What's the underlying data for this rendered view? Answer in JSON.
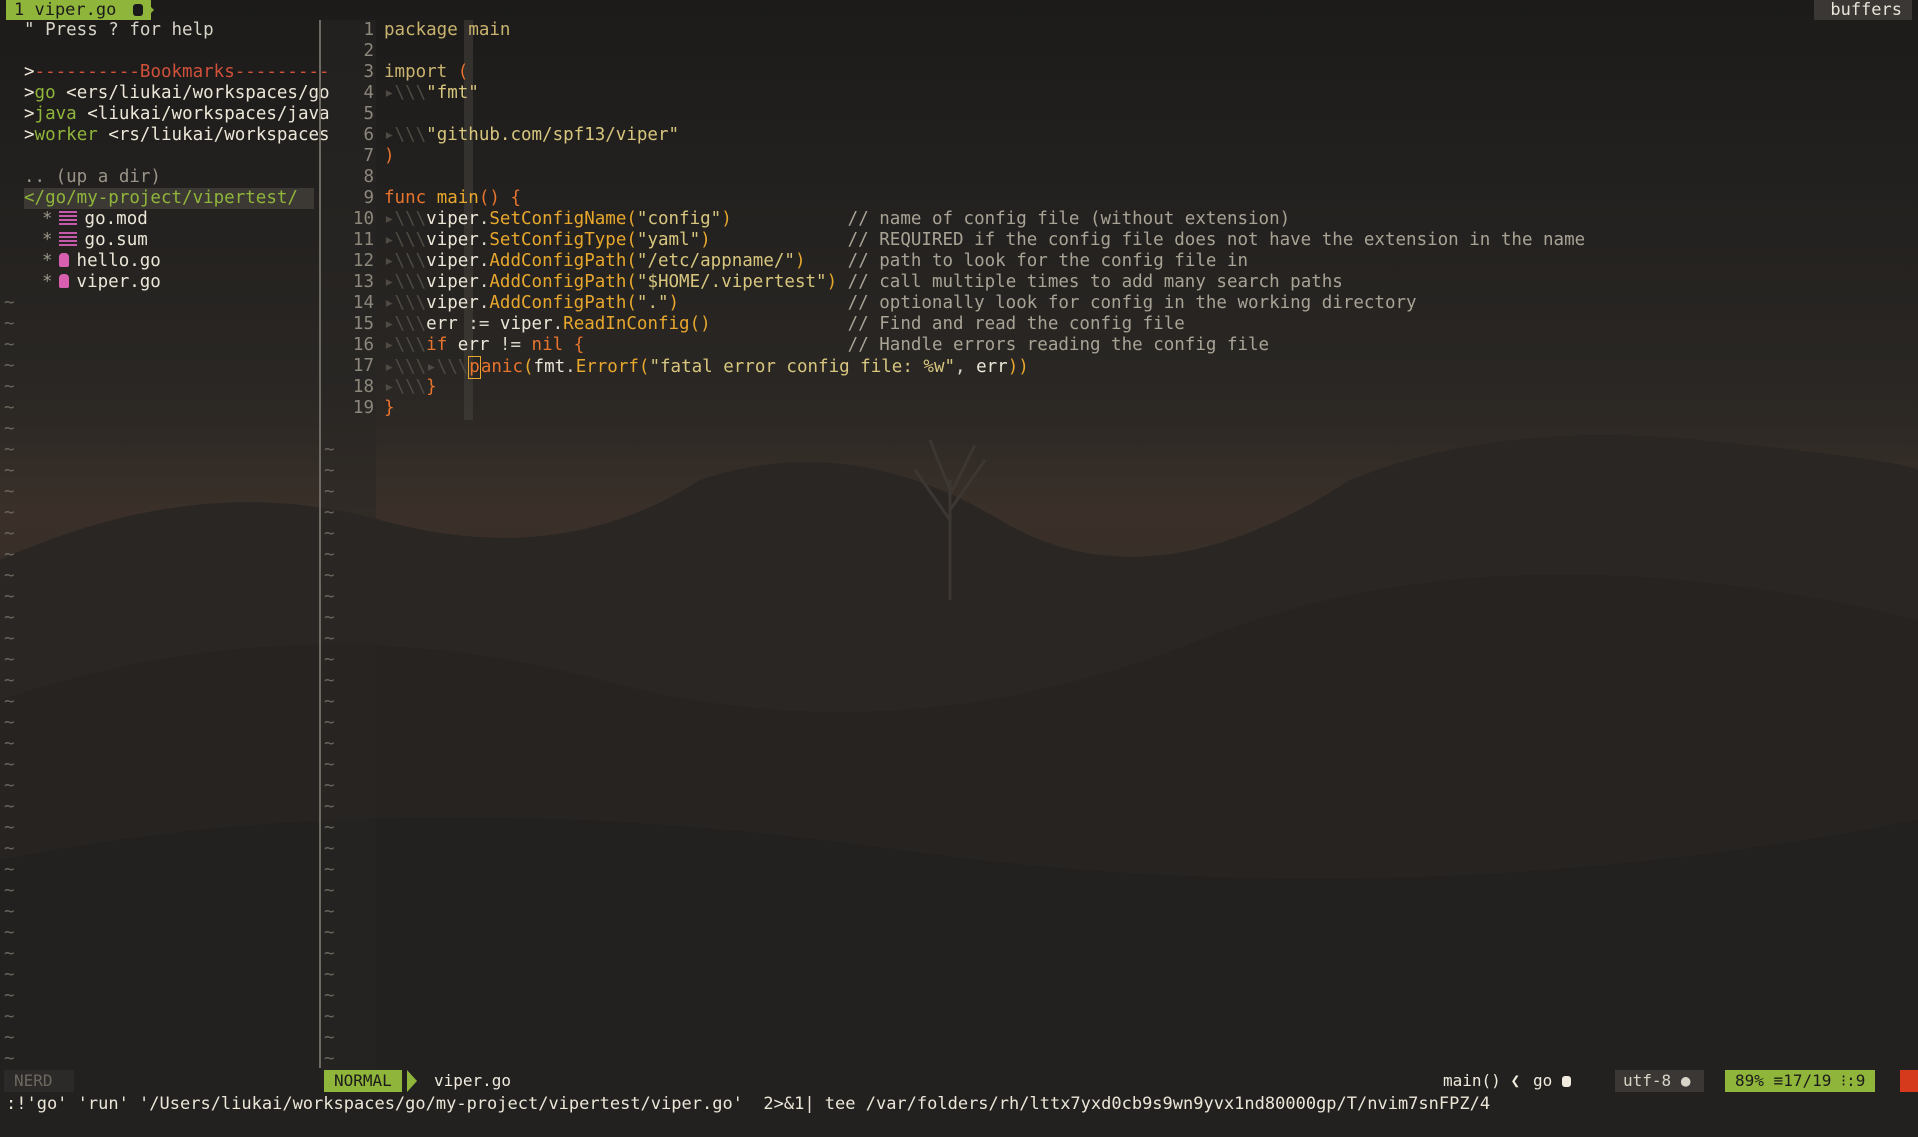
{
  "tabline": {
    "tab_label": "1 viper.go",
    "tab_icon": "gopher-icon",
    "buffers_label": "buffers"
  },
  "tree": {
    "help": "\" Press ? for help",
    "bookmarks_header": "----------Bookmarks---------",
    "bookmarks": [
      {
        "name": "go",
        "path": "<ers/liukai/workspaces/go"
      },
      {
        "name": "java",
        "path": "<liukai/workspaces/java"
      },
      {
        "name": "worker",
        "path": "<rs/liukai/workspaces"
      }
    ],
    "up_dir": ".. (up a dir)",
    "cwd": "</go/my-project/vipertest/",
    "files": [
      {
        "name": "go.mod",
        "icon": "text-file-icon"
      },
      {
        "name": "go.sum",
        "icon": "text-file-icon"
      },
      {
        "name": "hello.go",
        "icon": "gopher-icon"
      },
      {
        "name": "viper.go",
        "icon": "gopher-icon"
      }
    ],
    "tilde": "~"
  },
  "editor": {
    "lines": [
      {
        "n": "1",
        "code": "package main"
      },
      {
        "n": "2",
        "code": ""
      },
      {
        "n": "3",
        "code": "import ("
      },
      {
        "n": "4",
        "code": "\"fmt\""
      },
      {
        "n": "5",
        "code": ""
      },
      {
        "n": "6",
        "code": "\"github.com/spf13/viper\""
      },
      {
        "n": "7",
        "code": ")"
      },
      {
        "n": "8",
        "code": ""
      },
      {
        "n": "9",
        "code": "func main() {"
      },
      {
        "n": "10",
        "code": "viper.SetConfigName(\"config\")",
        "comment": "// name of config file (without extension)"
      },
      {
        "n": "11",
        "code": "viper.SetConfigType(\"yaml\")",
        "comment": "// REQUIRED if the config file does not have the extension in the name"
      },
      {
        "n": "12",
        "code": "viper.AddConfigPath(\"/etc/appname/\")",
        "comment": "// path to look for the config file in"
      },
      {
        "n": "13",
        "code": "viper.AddConfigPath(\"$HOME/.vipertest\")",
        "comment": "// call multiple times to add many search paths"
      },
      {
        "n": "14",
        "code": "viper.AddConfigPath(\".\")",
        "comment": "// optionally look for config in the working directory"
      },
      {
        "n": "15",
        "code": "err := viper.ReadInConfig()",
        "comment": "// Find and read the config file"
      },
      {
        "n": "16",
        "code": "if err != nil {",
        "comment": "// Handle errors reading the config file"
      },
      {
        "n": "17",
        "code": "panic(fmt.Errorf(\"fatal error config file: %w\", err))"
      },
      {
        "n": "18",
        "code": "}"
      },
      {
        "n": "19",
        "code": "}"
      }
    ]
  },
  "statusline": {
    "left_mode": "NERD",
    "mode": "NORMAL",
    "filename": "viper.go",
    "function": "main()",
    "filetype": "go",
    "encoding": "utf-8",
    "percent": "89%",
    "line_pos": "17/19",
    "col_pos": ":9"
  },
  "cmdline": ":!'go' 'run' '/Users/liukai/workspaces/go/my-project/vipertest/viper.go'  2>&1| tee /var/folders/rh/lttx7yxd0cb9s9wn9yvx1nd80000gp/T/nvim7snFPZ/4",
  "colors": {
    "accent_green": "#8fb53a",
    "keyword_orange": "#e8742d",
    "function_amber": "#e8a72d",
    "string_yellow": "#d8c67e",
    "bookmark_red": "#d0503a",
    "error_red": "#d63a1c"
  }
}
